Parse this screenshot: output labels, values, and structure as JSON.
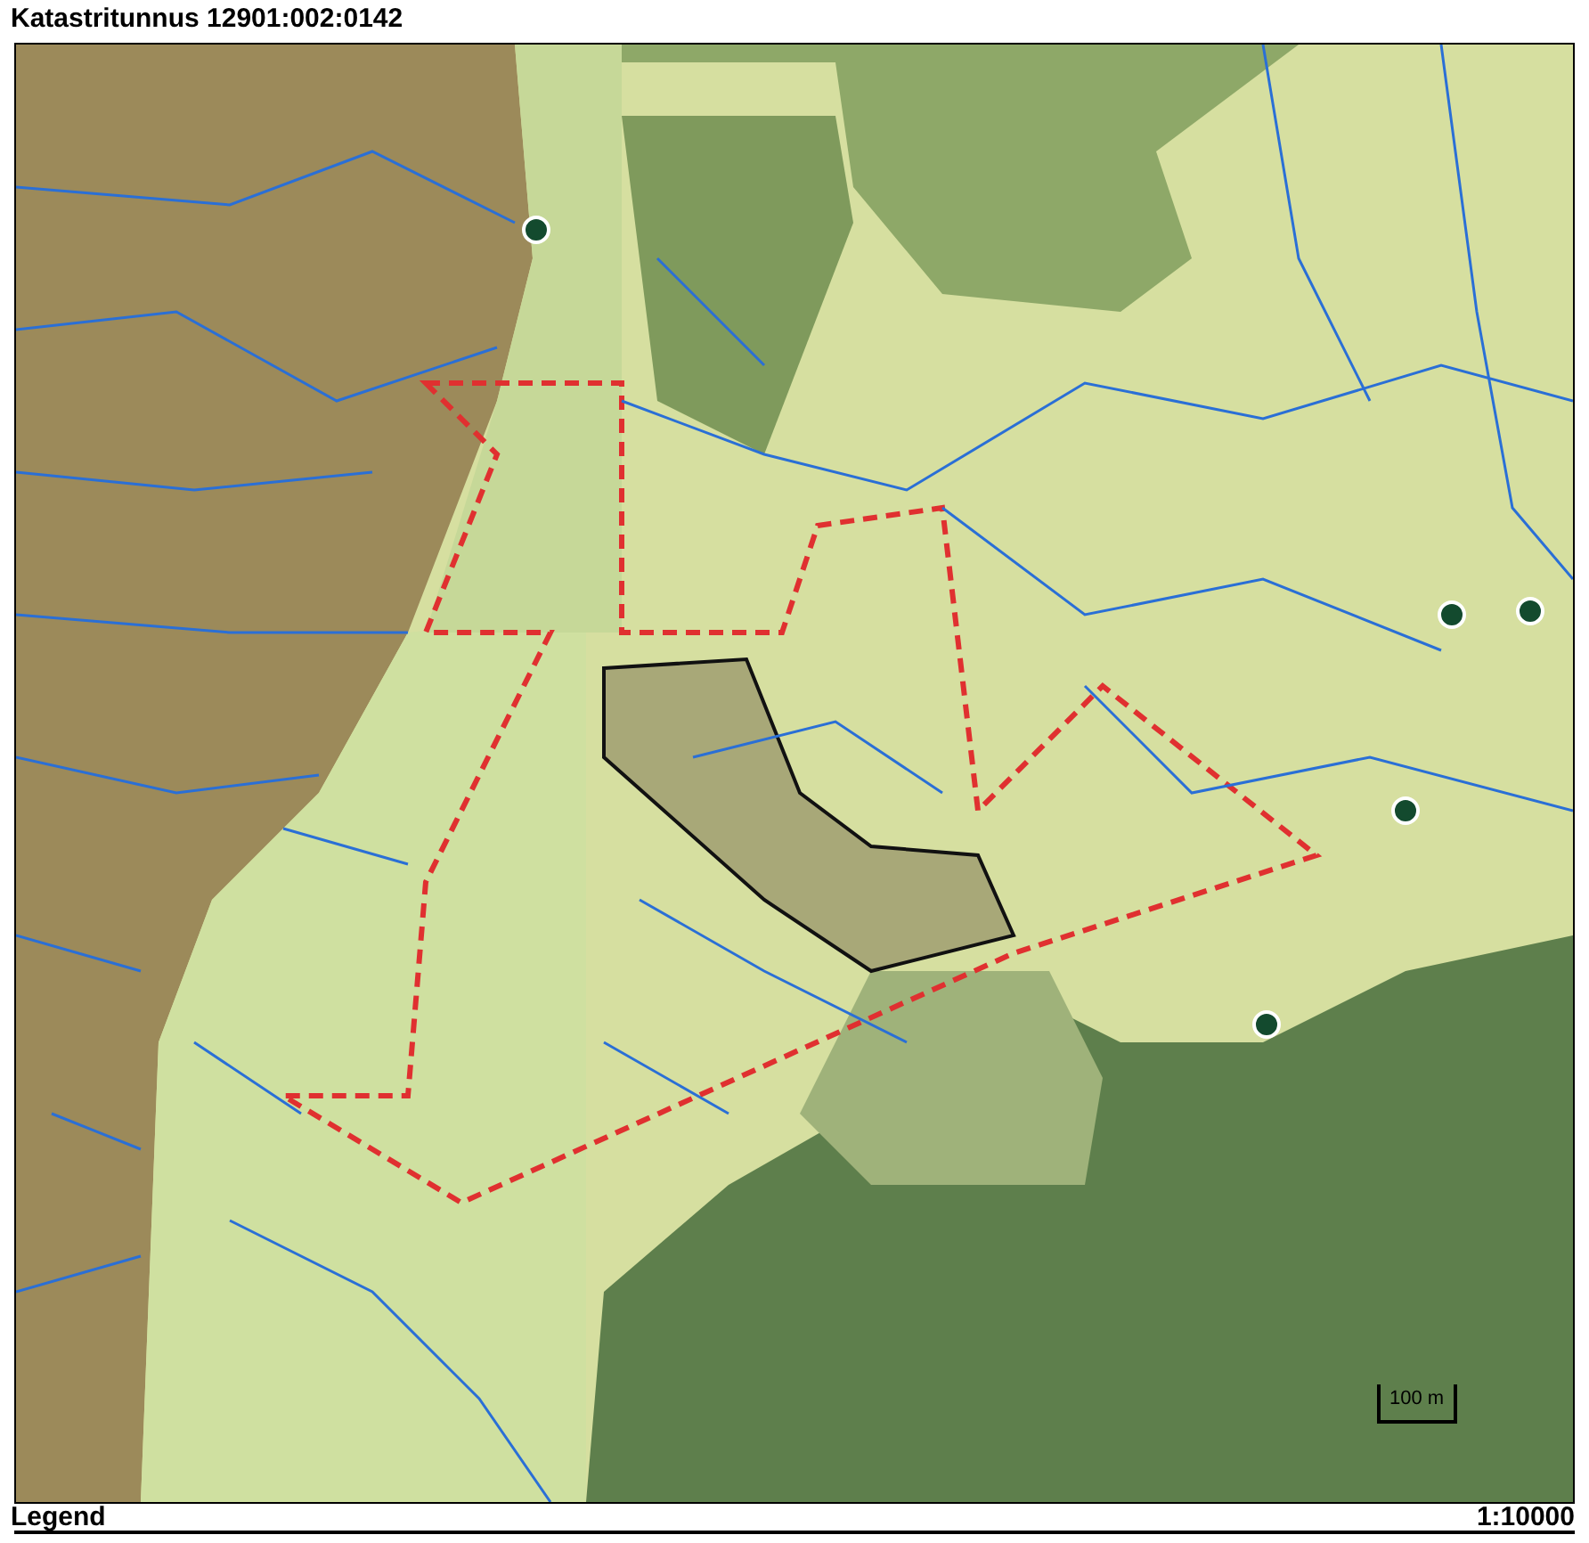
{
  "title": "Katastritunnus 12901:002:0142",
  "map": {
    "scale_bar": "100 m"
  },
  "footer": {
    "legend": "Legend",
    "scale": "1:10000"
  }
}
